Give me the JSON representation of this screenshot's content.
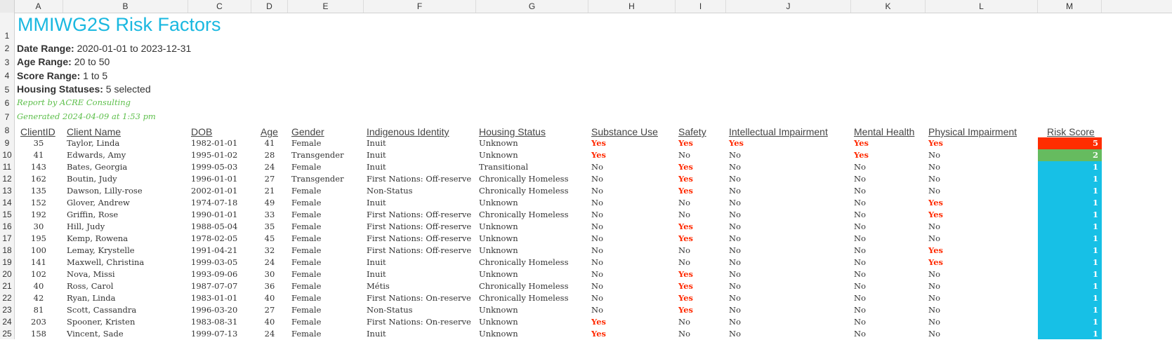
{
  "columns": [
    "A",
    "B",
    "C",
    "D",
    "E",
    "F",
    "G",
    "H",
    "I",
    "J",
    "K",
    "L",
    "M"
  ],
  "title": "MMIWG2S Risk Factors",
  "filters": [
    {
      "label": "Date Range:",
      "value": "2020-01-01 to 2023-12-31"
    },
    {
      "label": "Age Range:",
      "value": "20 to 50"
    },
    {
      "label": "Score Range:",
      "value": "1 to 5"
    },
    {
      "label": "Housing Statuses:",
      "value": "5 selected"
    }
  ],
  "report_by": "Report by ACRE Consulting",
  "generated": "Generated 2024-04-09 at  1:53 pm",
  "headers": [
    "ClientID",
    "Client Name",
    "DOB",
    "Age",
    "Gender",
    "Indigenous Identity",
    "Housing Status",
    "Substance Use",
    "Safety",
    "Intellectual Impairment",
    "Mental Health",
    "Physical Impairment",
    "Risk Score"
  ],
  "score_colors": {
    "5": "#ff2d00",
    "2": "#66bb5f",
    "1": "#17c0e6"
  },
  "rows": [
    [
      "35",
      "Taylor, Linda",
      "1982-01-01",
      "41",
      "Female",
      "Inuit",
      "Unknown",
      "Yes",
      "Yes",
      "Yes",
      "Yes",
      "Yes",
      "5"
    ],
    [
      "41",
      "Edwards, Amy",
      "1995-01-02",
      "28",
      "Transgender",
      "Inuit",
      "Unknown",
      "Yes",
      "No",
      "No",
      "Yes",
      "No",
      "2"
    ],
    [
      "143",
      "Bates, Georgia",
      "1999-05-03",
      "24",
      "Female",
      "Inuit",
      "Transitional",
      "No",
      "Yes",
      "No",
      "No",
      "No",
      "1"
    ],
    [
      "162",
      "Boutin, Judy",
      "1996-01-01",
      "27",
      "Transgender",
      "First Nations: Off-reserve",
      "Chronically Homeless",
      "No",
      "Yes",
      "No",
      "No",
      "No",
      "1"
    ],
    [
      "135",
      "Dawson, Lilly-rose",
      "2002-01-01",
      "21",
      "Female",
      "Non-Status",
      "Chronically Homeless",
      "No",
      "Yes",
      "No",
      "No",
      "No",
      "1"
    ],
    [
      "152",
      "Glover, Andrew",
      "1974-07-18",
      "49",
      "Female",
      "Inuit",
      "Unknown",
      "No",
      "No",
      "No",
      "No",
      "Yes",
      "1"
    ],
    [
      "192",
      "Griffin, Rose",
      "1990-01-01",
      "33",
      "Female",
      "First Nations: Off-reserve",
      "Chronically Homeless",
      "No",
      "No",
      "No",
      "No",
      "Yes",
      "1"
    ],
    [
      "30",
      "Hill, Judy",
      "1988-05-04",
      "35",
      "Female",
      "First Nations: Off-reserve",
      "Unknown",
      "No",
      "Yes",
      "No",
      "No",
      "No",
      "1"
    ],
    [
      "195",
      "Kemp, Rowena",
      "1978-02-05",
      "45",
      "Female",
      "First Nations: Off-reserve",
      "Unknown",
      "No",
      "Yes",
      "No",
      "No",
      "No",
      "1"
    ],
    [
      "100",
      "Lemay, Krystelle",
      "1991-04-21",
      "32",
      "Female",
      "First Nations: Off-reserve",
      "Unknown",
      "No",
      "No",
      "No",
      "No",
      "Yes",
      "1"
    ],
    [
      "141",
      "Maxwell, Christina",
      "1999-03-05",
      "24",
      "Female",
      "Inuit",
      "Chronically Homeless",
      "No",
      "No",
      "No",
      "No",
      "Yes",
      "1"
    ],
    [
      "102",
      "Nova, Missi",
      "1993-09-06",
      "30",
      "Female",
      "Inuit",
      "Unknown",
      "No",
      "Yes",
      "No",
      "No",
      "No",
      "1"
    ],
    [
      "40",
      "Ross, Carol",
      "1987-07-07",
      "36",
      "Female",
      "Métis",
      "Chronically Homeless",
      "No",
      "Yes",
      "No",
      "No",
      "No",
      "1"
    ],
    [
      "42",
      "Ryan, Linda",
      "1983-01-01",
      "40",
      "Female",
      "First Nations: On-reserve",
      "Chronically Homeless",
      "No",
      "Yes",
      "No",
      "No",
      "No",
      "1"
    ],
    [
      "81",
      "Scott, Cassandra",
      "1996-03-20",
      "27",
      "Female",
      "Non-Status",
      "Unknown",
      "No",
      "Yes",
      "No",
      "No",
      "No",
      "1"
    ],
    [
      "203",
      "Spooner, Kristen",
      "1983-08-31",
      "40",
      "Female",
      "First Nations: On-reserve",
      "Unknown",
      "Yes",
      "No",
      "No",
      "No",
      "No",
      "1"
    ],
    [
      "158",
      "Vincent, Sade",
      "1999-07-13",
      "24",
      "Female",
      "Inuit",
      "Unknown",
      "Yes",
      "No",
      "No",
      "No",
      "No",
      "1"
    ]
  ]
}
